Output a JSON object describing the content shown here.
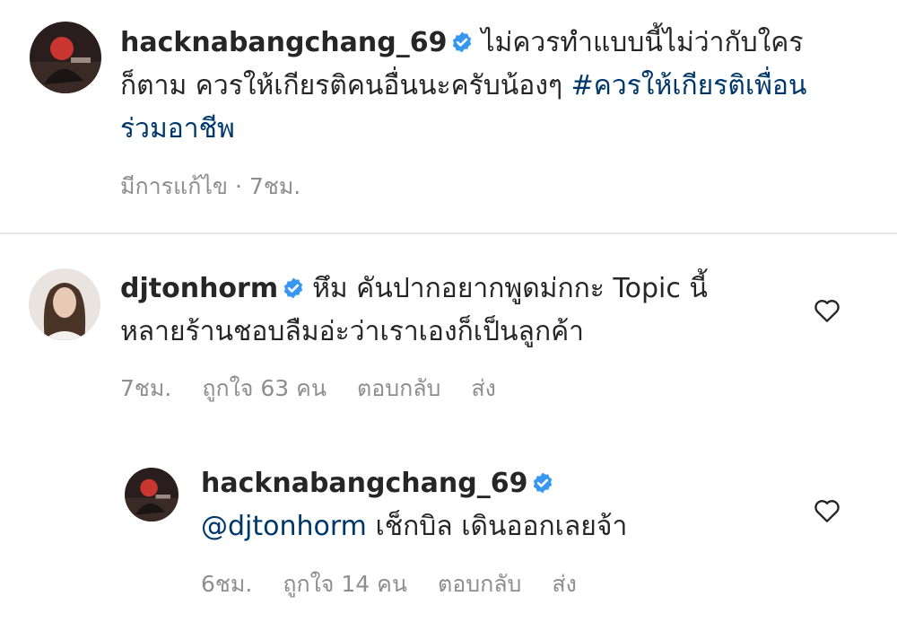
{
  "caption": {
    "username": "hacknabangchang_69",
    "text": "ไม่ควรทำแบบนี้ไม่ว่ากับใครก็ตาม ควรให้เกียรติคนอื่นนะครับน้องๆ",
    "hashtag": "#ควรให้เกียรติเพื่อนร่วมอาชีพ",
    "edited_label": "มีการแก้ไข",
    "separator": "·",
    "time": "7ชม."
  },
  "comment": {
    "username": "djtonhorm",
    "text": "หึม คันปากอยากพูดม่กกะ Topic นี้ หลายร้านชอบลืมอ่ะว่าเราเองก็เป็นลูกค้า",
    "time": "7ชม.",
    "likes": "ถูกใจ 63 คน",
    "reply_label": "ตอบกลับ",
    "send_label": "ส่ง"
  },
  "reply": {
    "username": "hacknabangchang_69",
    "mention": "@djtonhorm",
    "text": "เช็กบิล เดินออกเลยจ้า",
    "time": "6ชม.",
    "likes": "ถูกใจ 14 คน",
    "reply_label": "ตอบกลับ",
    "send_label": "ส่ง"
  },
  "icons": {
    "verified": "verified-badge-icon",
    "like": "heart-icon"
  },
  "colors": {
    "verified": "#3897f0",
    "hashtag": "#00376b",
    "meta": "#8e8e8e",
    "divider": "#e6e6e6"
  }
}
